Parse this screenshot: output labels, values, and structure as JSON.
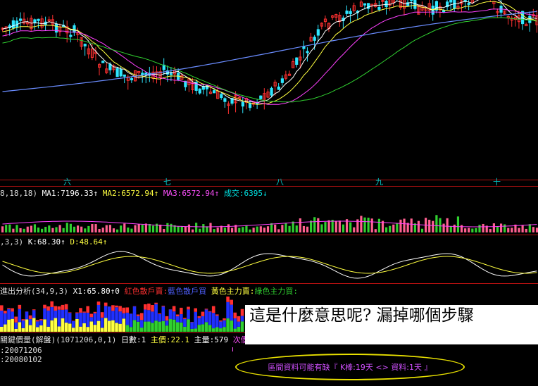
{
  "colors": {
    "up": "#2ee6ff",
    "down": "#ff3030",
    "ma_white": "#ffffff",
    "ma_yellow": "#ffff40",
    "ma_magenta": "#ff40ff",
    "ma_green": "#30d030",
    "ma_blue": "#6a8cff",
    "separator": "#b01010",
    "cyan": "#00e0e0",
    "magenta": "#ff50ff"
  },
  "month_labels": [
    "六",
    "七",
    "八",
    "九",
    "十"
  ],
  "indicators": {
    "volume": {
      "params": "8,18,18)",
      "ma1": "MA1:7196.33↑",
      "ma2": "MA2:6572.94↑",
      "ma3": "MA3:6572.94↑",
      "turnover": "成交:6395↓"
    },
    "kd": {
      "params": ",3,3)",
      "k": "K:68.30↑",
      "d": "D:48.64↑"
    },
    "flow": {
      "title": "進出分析(34,9,3)",
      "x1": "X1:65.80↑0",
      "red_retail": "紅色散戶賣:",
      "blue_retail": "藍色散戶買",
      "yellow_main": "黃色主力賣:",
      "green_main": "綠色主力買:"
    },
    "key_price": {
      "title": "關鍵價量(解盤)(1071206,0,1)",
      "days": "日數:1",
      "main_price": "主價:22.1",
      "main_volume": "主量:579",
      "next_price": "次價"
    }
  },
  "dates": [
    ":20071206",
    ":20080102"
  ],
  "overlay_text": "這是什麼意思呢? 漏掉哪個步驟",
  "notice": "區間資料可能有缺『 K棒:19天 <> 資料:1天 』"
}
